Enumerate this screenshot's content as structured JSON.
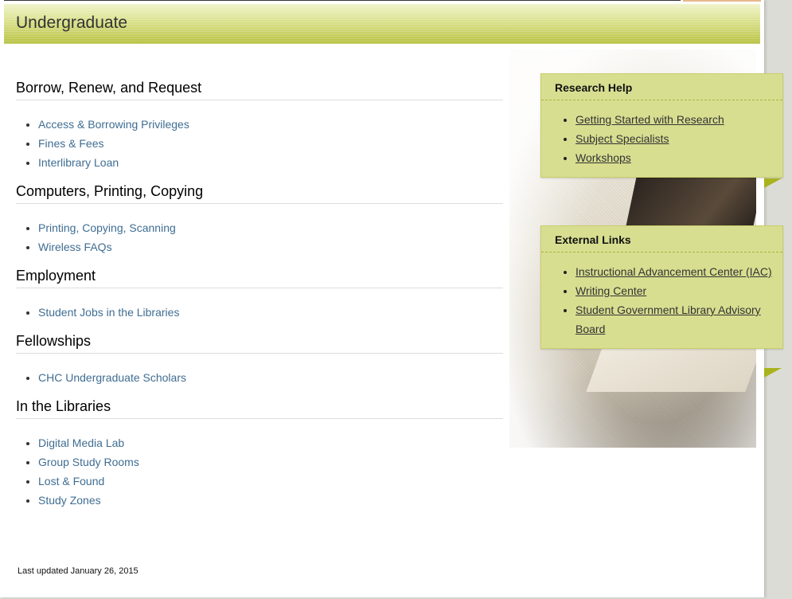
{
  "header": {
    "title": "Undergraduate"
  },
  "sections": [
    {
      "heading": "Borrow, Renew, and Request",
      "links": [
        "Access & Borrowing Privileges",
        "Fines & Fees",
        "Interlibrary Loan"
      ]
    },
    {
      "heading": "Computers, Printing, Copying",
      "links": [
        "Printing, Copying, Scanning",
        "Wireless FAQs"
      ]
    },
    {
      "heading": "Employment",
      "links": [
        "Student Jobs in the Libraries"
      ]
    },
    {
      "heading": "Fellowships",
      "links": [
        "CHC Undergraduate Scholars"
      ]
    },
    {
      "heading": "In the Libraries",
      "links": [
        "Digital Media Lab",
        "Group Study Rooms",
        "Lost & Found",
        "Study Zones"
      ]
    }
  ],
  "research_help": {
    "title": "Research Help",
    "links": [
      "Getting Started with Research",
      "Subject Specialists",
      "Workshops"
    ]
  },
  "external_links": {
    "title": "External Links",
    "links": [
      "Instructional Advancement Center (IAC)",
      "Writing Center",
      "Student Government Library Advisory Board"
    ]
  },
  "footer": {
    "updated": "Last updated January 26, 2015"
  },
  "colors": {
    "link": "#3f6d92",
    "header_green": "#b8c241",
    "box_bg": "#d8de90"
  }
}
